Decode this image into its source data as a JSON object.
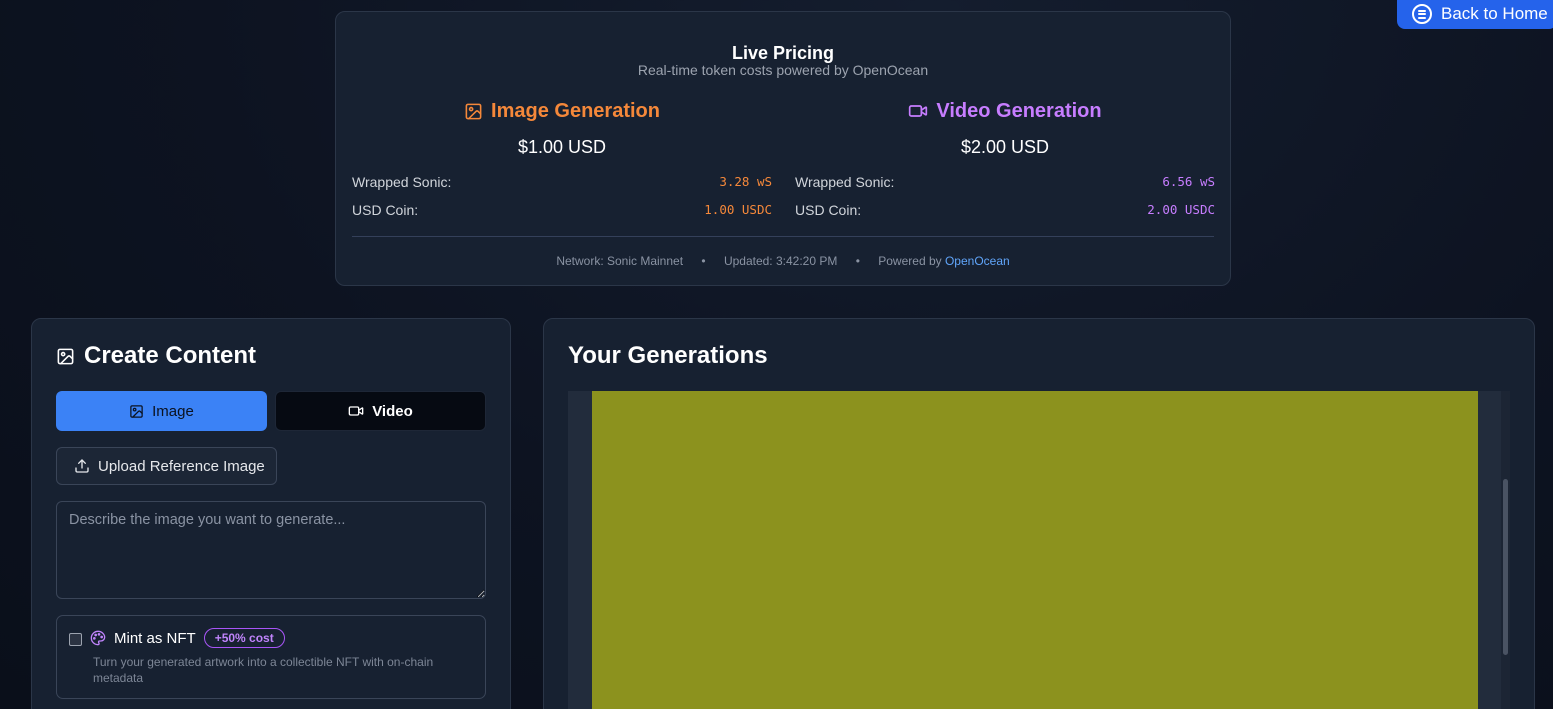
{
  "header": {
    "back_label": "Back to Home"
  },
  "pricing": {
    "title": "Live Pricing",
    "subtitle": "Real-time token costs powered by OpenOcean",
    "image": {
      "title": "Image Generation",
      "price": "$1.00 USD",
      "rows": [
        {
          "label": "Wrapped Sonic:",
          "value": "3.28 wS"
        },
        {
          "label": "USD Coin:",
          "value": "1.00 USDC"
        }
      ],
      "color": "#f5883a"
    },
    "video": {
      "title": "Video Generation",
      "price": "$2.00 USD",
      "rows": [
        {
          "label": "Wrapped Sonic:",
          "value": "6.56 wS"
        },
        {
          "label": "USD Coin:",
          "value": "2.00 USDC"
        }
      ],
      "color": "#c77dff"
    },
    "footer": {
      "network": "Network: Sonic Mainnet",
      "updated": "Updated: 3:42:20 PM",
      "powered_prefix": "Powered by",
      "powered_link": "OpenOcean",
      "separator": "•"
    }
  },
  "create": {
    "title": "Create Content",
    "tabs": {
      "image": "Image",
      "video": "Video",
      "active": "image"
    },
    "upload_label": "Upload Reference Image",
    "prompt": {
      "placeholder": "Describe the image you want to generate...",
      "value": ""
    },
    "nft": {
      "label": "Mint as NFT",
      "badge": "+50% cost",
      "description": "Turn your generated artwork into a collectible NFT with on-chain metadata",
      "checked": false
    }
  },
  "generations": {
    "title": "Your Generations",
    "preview_color": "#8c921e"
  },
  "colors": {
    "accent_blue": "#3b82f6",
    "back_button": "#2563eb",
    "link": "#60a5fa",
    "badge_purple": "#a855f7"
  }
}
